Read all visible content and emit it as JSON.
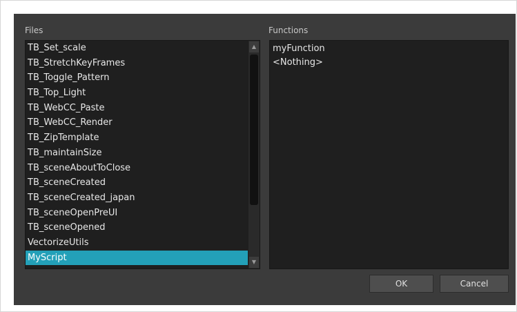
{
  "files": {
    "label": "Files",
    "items": [
      {
        "label": "TB_Set_scale"
      },
      {
        "label": "TB_StretchKeyFrames"
      },
      {
        "label": "TB_Toggle_Pattern"
      },
      {
        "label": "TB_Top_Light"
      },
      {
        "label": "TB_WebCC_Paste"
      },
      {
        "label": "TB_WebCC_Render"
      },
      {
        "label": "TB_ZipTemplate"
      },
      {
        "label": "TB_maintainSize"
      },
      {
        "label": "TB_sceneAboutToClose"
      },
      {
        "label": "TB_sceneCreated"
      },
      {
        "label": "TB_sceneCreated_japan"
      },
      {
        "label": "TB_sceneOpenPreUI"
      },
      {
        "label": "TB_sceneOpened"
      },
      {
        "label": "VectorizeUtils"
      },
      {
        "label": "MyScript",
        "selected": true
      }
    ],
    "scrollbar": {
      "up_icon": "▲",
      "down_icon": "▼"
    }
  },
  "functions": {
    "label": "Functions",
    "items": [
      {
        "label": "myFunction"
      },
      {
        "label": "<Nothing>"
      }
    ]
  },
  "buttons": {
    "ok_label": "OK",
    "cancel_label": "Cancel"
  },
  "colors": {
    "dialog_bg": "#3b3b3b",
    "list_bg": "#1f1f1f",
    "selection": "#23a0b8",
    "button_bg": "#4e4e4e"
  }
}
